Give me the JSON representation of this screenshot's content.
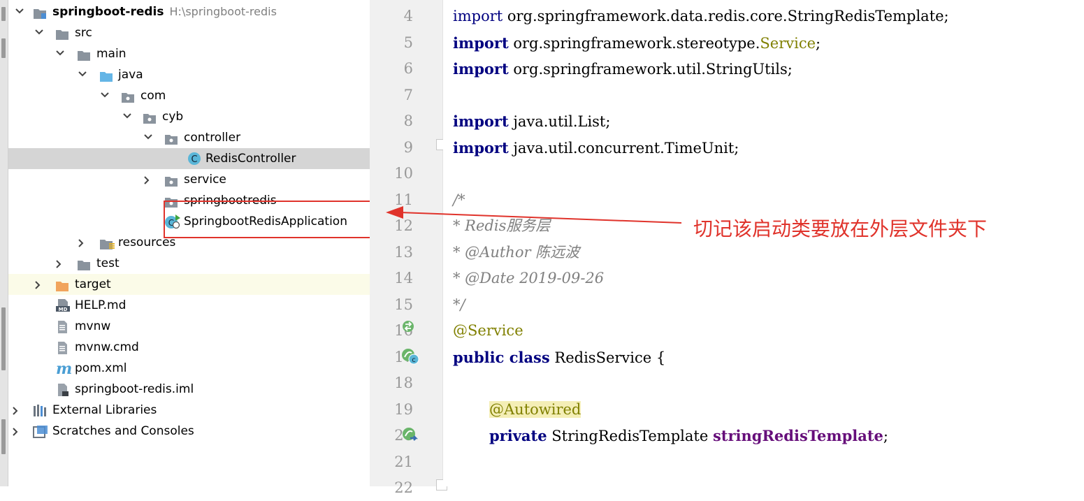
{
  "project_tree": {
    "root": {
      "name": "springboot-redis",
      "path": "H:\\springboot-redis"
    },
    "src": "src",
    "main": "main",
    "java": "java",
    "com": "com",
    "cyb": "cyb",
    "controller": "controller",
    "redis_controller": "RedisController",
    "service": "service",
    "springbootredis": "springbootredis",
    "app_class": "SpringbootRedisApplication",
    "resources": "resources",
    "test": "test",
    "target": "target",
    "help_md": "HELP.md",
    "mvnw": "mvnw",
    "mvnw_cmd": "mvnw.cmd",
    "pom": "pom.xml",
    "iml": "springboot-redis.iml",
    "external_libraries": "External Libraries",
    "scratches": "Scratches and Consoles"
  },
  "editor": {
    "line_numbers": [
      "4",
      "5",
      "6",
      "7",
      "8",
      "9",
      "10",
      "11",
      "12",
      "13",
      "14",
      "15",
      "16",
      "17",
      "18",
      "19",
      "20",
      "21",
      "22"
    ],
    "lines": {
      "l4_kw": "import",
      "l4_rest": " org.springframework.data.redis.core.StringRedisTemplate;",
      "l5_kw": "import",
      "l5_rest": " org.springframework.stereotype.",
      "l5_svc": "Service",
      "l5_end": ";",
      "l6_kw": "import",
      "l6_rest": " org.springframework.util.StringUtils;",
      "l8_kw": "import",
      "l8_rest": " java.util.List;",
      "l9_kw": "import",
      "l9_rest": " java.util.concurrent.TimeUnit;",
      "l11": "/*",
      "l12": "* Redis服务层",
      "l13": "* @Author 陈远波",
      "l14": "* @Date 2019-09-26",
      "l15": "*/",
      "l16": "@Service",
      "l17_kw": "public class",
      "l17_rest": " RedisService {",
      "l19": "@Autowired",
      "l20_kw": "private",
      "l20_type": " StringRedisTemplate ",
      "l20_field": "stringRedisTemplate",
      "l20_end": ";"
    }
  },
  "annotation_note": "切记该启动类要放在外层文件夹下",
  "colors": {
    "highlight_red": "#e0332b",
    "keyword": "#000080",
    "annotation": "#808000",
    "comment": "#808080",
    "field": "#660e7a"
  }
}
